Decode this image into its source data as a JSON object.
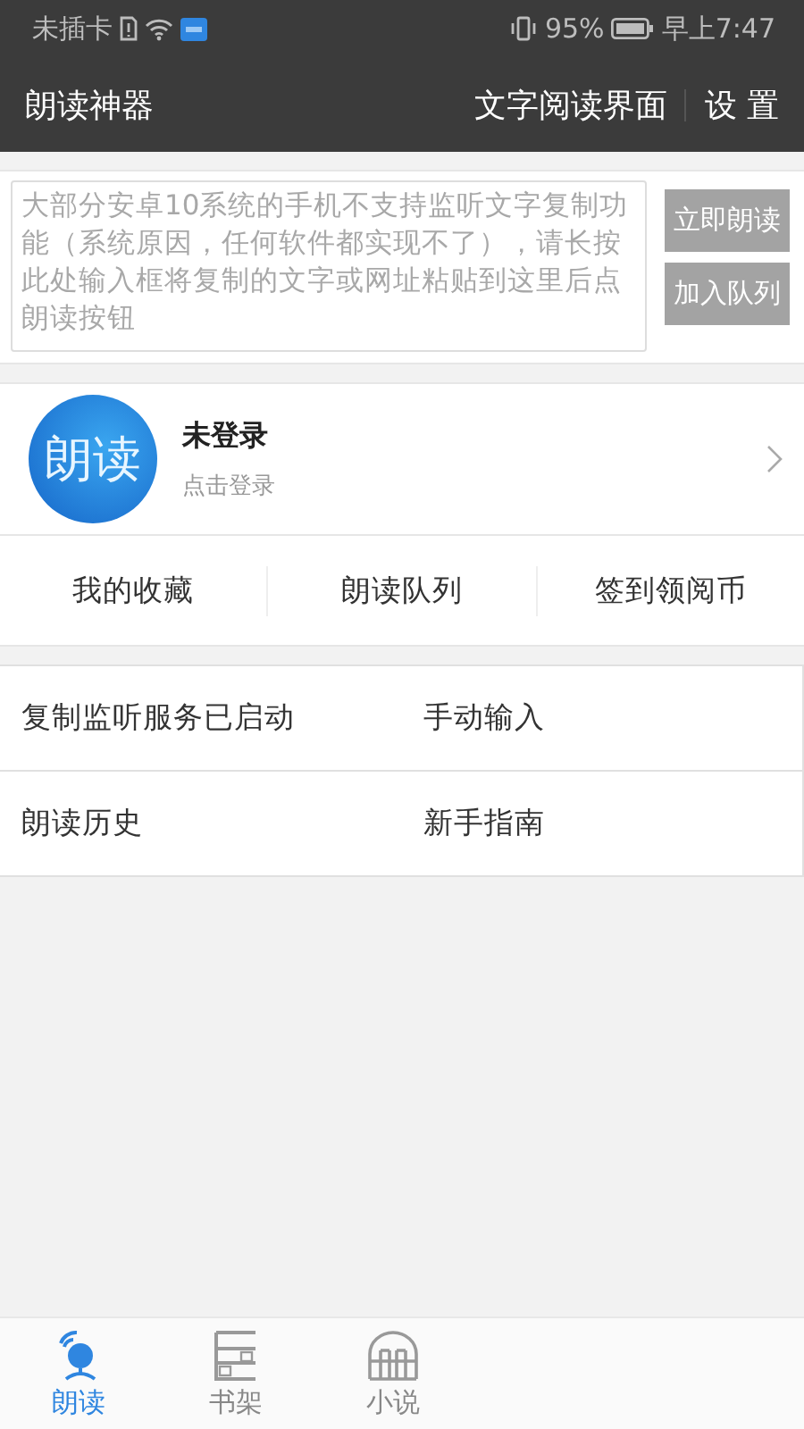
{
  "status_bar": {
    "carrier": "未插卡",
    "battery": "95%",
    "time": "早上7:47"
  },
  "app_bar": {
    "title": "朗读神器",
    "actions": [
      "文字阅读界面",
      "设 置"
    ]
  },
  "input": {
    "placeholder": "大部分安卓10系统的手机不支持监听文字复制功能（系统原因，任何软件都实现不了），请长按此处输入框将复制的文字或网址粘贴到这里后点朗读按钮",
    "buttons": [
      {
        "label": "立即朗读",
        "disabled": true
      },
      {
        "label": "加入队列",
        "disabled": true
      }
    ]
  },
  "profile": {
    "avatar_text": "朗读",
    "name": "未登录",
    "hint": "点击登录"
  },
  "shortcuts": [
    "我的收藏",
    "朗读队列",
    "签到领阅币"
  ],
  "menu": [
    "复制监听服务已启动",
    "手动输入",
    "朗读历史",
    "新手指南"
  ],
  "tabs": [
    {
      "label": "朗读",
      "selected": true
    },
    {
      "label": "书架",
      "selected": false
    },
    {
      "label": "小说",
      "selected": false
    }
  ]
}
